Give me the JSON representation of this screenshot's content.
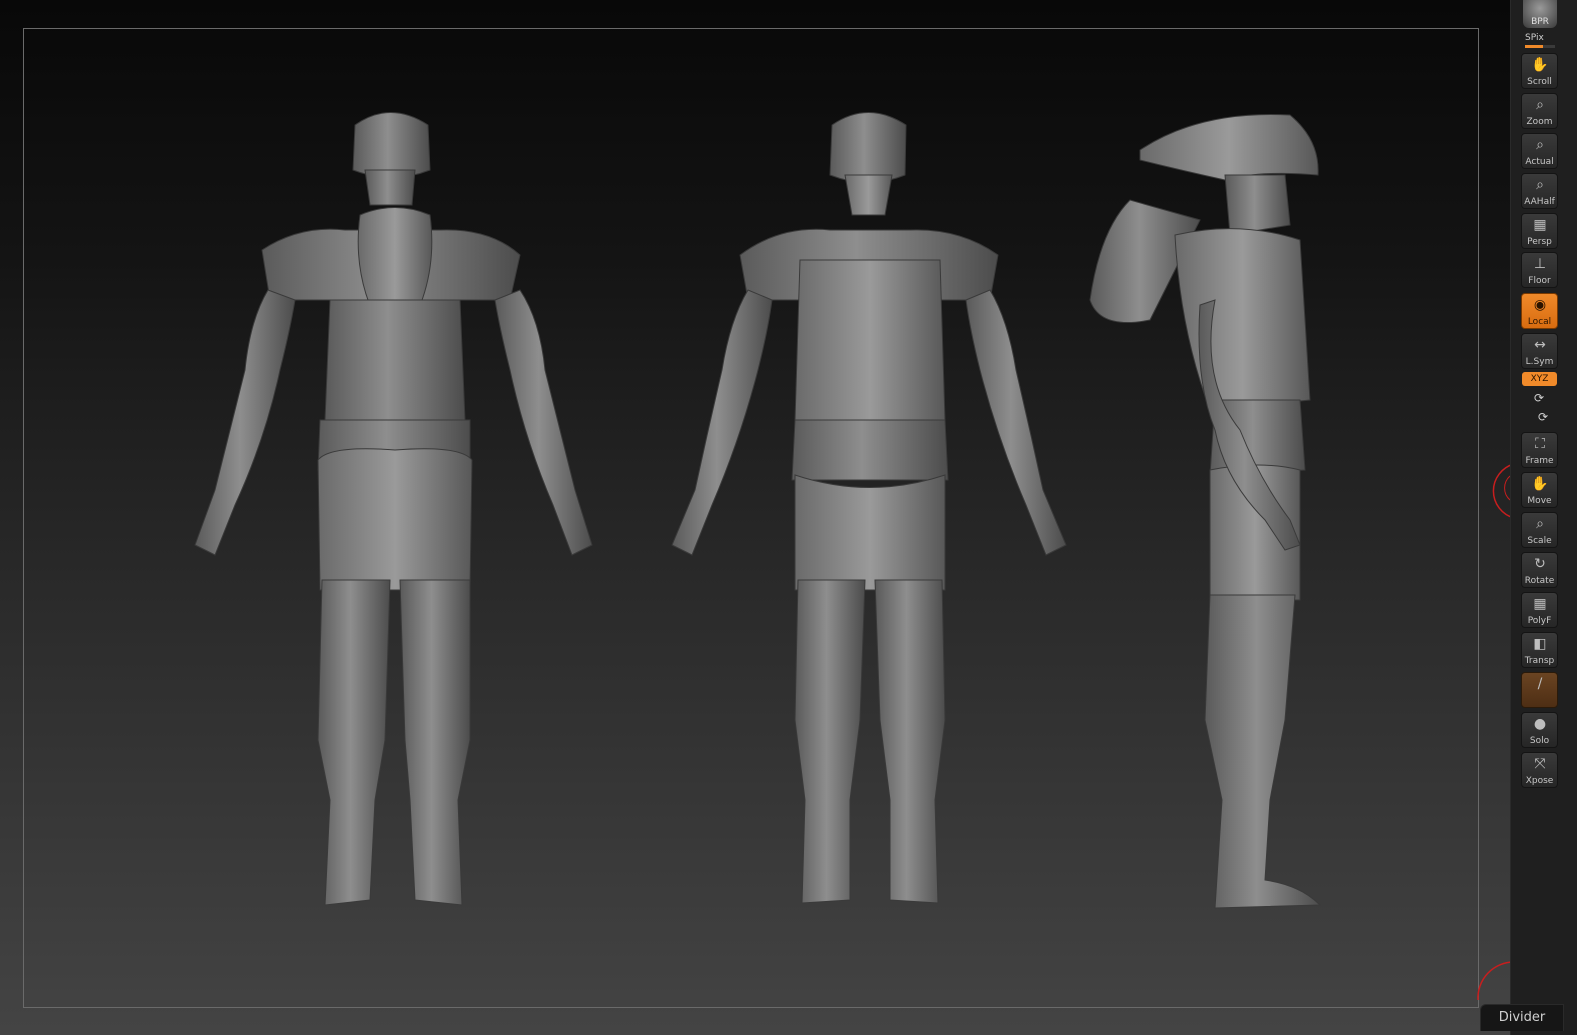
{
  "shelf": {
    "bpr_label": "BPR",
    "spix_label": "SPix",
    "spix_level": 0.6,
    "tools": [
      {
        "id": "scroll",
        "label": "Scroll",
        "icon": "hand-icon",
        "active": false
      },
      {
        "id": "zoom",
        "label": "Zoom",
        "icon": "magnifier-icon",
        "active": false
      },
      {
        "id": "actual",
        "label": "Actual",
        "icon": "magnifier-icon",
        "active": false
      },
      {
        "id": "aahalf",
        "label": "AAHalf",
        "icon": "magnifier-icon",
        "active": false
      },
      {
        "id": "persp",
        "label": "Persp",
        "icon": "grid-icon",
        "active": false
      },
      {
        "id": "floor",
        "label": "Floor",
        "icon": "floor-icon",
        "active": false
      },
      {
        "id": "local",
        "label": "Local",
        "icon": "local-icon",
        "active": true
      },
      {
        "id": "lsym",
        "label": "L.Sym",
        "icon": "arrows-icon",
        "active": false
      },
      {
        "id": "frame",
        "label": "Frame",
        "icon": "frame-icon",
        "active": false
      },
      {
        "id": "move",
        "label": "Move",
        "icon": "hand-icon",
        "active": false
      },
      {
        "id": "scale",
        "label": "Scale",
        "icon": "magnifier-icon",
        "active": false
      },
      {
        "id": "rotate",
        "label": "Rotate",
        "icon": "rotate-icon",
        "active": false
      },
      {
        "id": "polyf",
        "label": "PolyF",
        "icon": "grid-icon",
        "active": false
      },
      {
        "id": "transp",
        "label": "Transp",
        "icon": "transparency-icon",
        "active": false
      },
      {
        "id": "ghost",
        "label": "",
        "icon": "brush-icon",
        "active": false
      },
      {
        "id": "solo",
        "label": "Solo",
        "icon": "spheres-icon",
        "active": false
      },
      {
        "id": "xpose",
        "label": "Xpose",
        "icon": "expand-icon",
        "active": false
      }
    ],
    "xyz_label": "XYZ"
  },
  "bottom_tab": {
    "label": "Divider"
  },
  "colors": {
    "accent": "#f08a2a",
    "panel": "#1f1f1f",
    "marker": "#c81e1e"
  }
}
